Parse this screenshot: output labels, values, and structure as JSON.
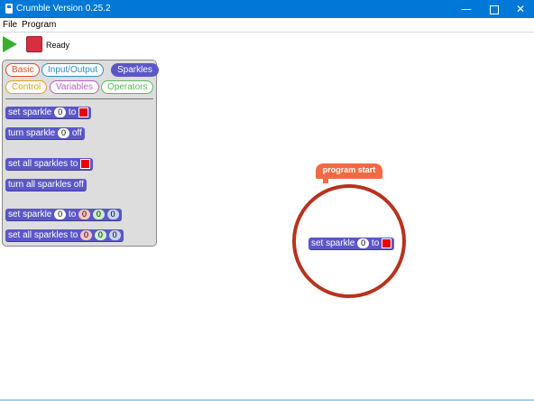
{
  "window": {
    "title": "Crumble Version 0.25.2",
    "minimize": "—",
    "close": "✕"
  },
  "menu": {
    "items": [
      "File",
      "Program"
    ]
  },
  "toolbar": {
    "status": "Ready"
  },
  "palette": {
    "categories": [
      "Basic",
      "Input/Output",
      "Sparkles",
      "Control",
      "Variables",
      "Operators"
    ],
    "active_category": "Sparkles",
    "blocks": {
      "set_sparkle": {
        "label1": "set sparkle",
        "value": "0",
        "label2": "to",
        "color": "#ee0000"
      },
      "turn_sparkle_off": {
        "label1": "turn sparkle",
        "value": "0",
        "label2": "off"
      },
      "set_all_sparkles": {
        "label1": "set all sparkles to",
        "color": "#ee0000"
      },
      "turn_all_sparkles_off": {
        "label1": "turn all sparkles off"
      },
      "set_sparkle_rgb": {
        "label1": "set sparkle",
        "index": "0",
        "label2": "to",
        "r": "0",
        "g": "0",
        "b": "0"
      },
      "set_all_sparkles_rgb": {
        "label1": "set all sparkles to",
        "r": "0",
        "g": "0",
        "b": "0"
      }
    }
  },
  "workspace": {
    "hat_label": "program start",
    "block": {
      "label1": "set sparkle",
      "value": "0",
      "label2": "to",
      "color": "#ee0000"
    },
    "highlight_color": "#b8321e"
  },
  "colors": {
    "titlebar": "#0078d7",
    "sparkles": "#5b57c7",
    "hat": "#f16a43"
  }
}
